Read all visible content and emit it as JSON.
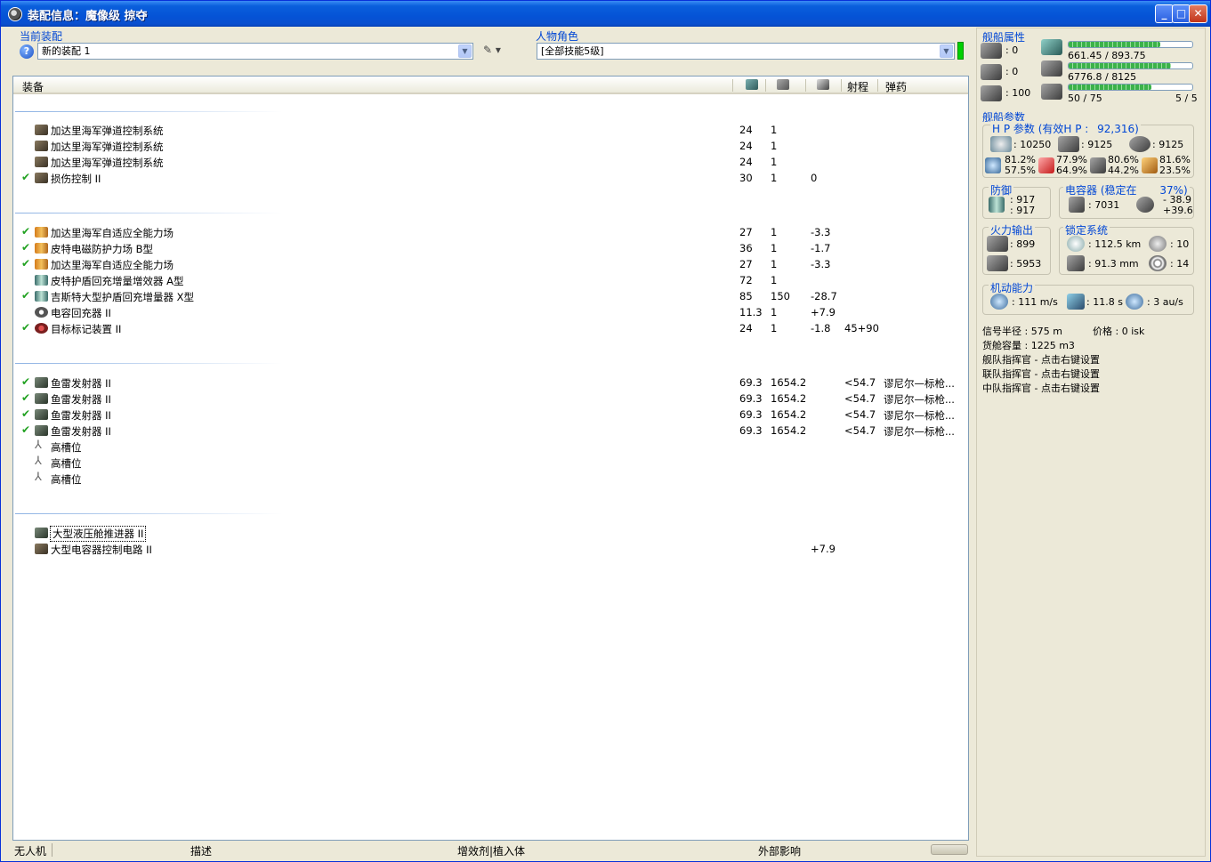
{
  "window": {
    "title": "装配信息：魔像级 掠夺",
    "buttons": {
      "minimize": "_",
      "maximize": "□",
      "close": "✕"
    }
  },
  "fitting": {
    "label": "当前装配",
    "value": "新的装配  1",
    "arrow": "▼",
    "help": "?",
    "tools": "✎ ▾"
  },
  "character": {
    "label": "人物角色",
    "value": "[全部技能5级]",
    "arrow": "▼"
  },
  "list": {
    "headers": {
      "equipment": "装备",
      "range": "射程",
      "ammo": "弹药"
    },
    "rows": [
      {
        "check": "",
        "icon": "module",
        "name": "加达里海军弹道控制系统",
        "c1": "24",
        "c2": "1",
        "c3": "",
        "c4": "",
        "c5": ""
      },
      {
        "check": "",
        "icon": "module",
        "name": "加达里海军弹道控制系统",
        "c1": "24",
        "c2": "1",
        "c3": "",
        "c4": "",
        "c5": ""
      },
      {
        "check": "",
        "icon": "module",
        "name": "加达里海军弹道控制系统",
        "c1": "24",
        "c2": "1",
        "c3": "",
        "c4": "",
        "c5": ""
      },
      {
        "check": "✔",
        "icon": "module",
        "name": "损伤控制 II",
        "c1": "30",
        "c2": "1",
        "c3": "0",
        "c4": "",
        "c5": ""
      },
      {
        "check": "✔",
        "icon": "shield",
        "name": "加达里海军自适应全能力场",
        "c1": "27",
        "c2": "1",
        "c3": "-3.3",
        "c4": "",
        "c5": ""
      },
      {
        "check": "✔",
        "icon": "shield",
        "name": "皮特电磁防护力场 B型",
        "c1": "36",
        "c2": "1",
        "c3": "-1.7",
        "c4": "",
        "c5": ""
      },
      {
        "check": "✔",
        "icon": "shield",
        "name": "加达里海军自适应全能力场",
        "c1": "27",
        "c2": "1",
        "c3": "-3.3",
        "c4": "",
        "c5": ""
      },
      {
        "check": "",
        "icon": "shield-b",
        "name": "皮特护盾回充增量增效器 A型",
        "c1": "72",
        "c2": "1",
        "c3": "",
        "c4": "",
        "c5": ""
      },
      {
        "check": "✔",
        "icon": "shield-b",
        "name": "吉斯特大型护盾回充增量器 X型",
        "c1": "85",
        "c2": "150",
        "c3": "-28.7",
        "c4": "",
        "c5": ""
      },
      {
        "check": "",
        "icon": "cap",
        "name": "电容回充器 II",
        "c1": "11.3",
        "c2": "1",
        "c3": "+7.9",
        "c4": "",
        "c5": ""
      },
      {
        "check": "✔",
        "icon": "target",
        "name": "目标标记装置 II",
        "c1": "24",
        "c2": "1",
        "c3": "-1.8",
        "c4": "45+90",
        "c5": ""
      },
      {
        "check": "✔",
        "icon": "launcher",
        "name": "鱼雷发射器 II",
        "c1": "69.3",
        "c2": "1654.2",
        "c3": "",
        "c4": "<54.7",
        "c5": "谬尼尔—标枪..."
      },
      {
        "check": "✔",
        "icon": "launcher",
        "name": "鱼雷发射器 II",
        "c1": "69.3",
        "c2": "1654.2",
        "c3": "",
        "c4": "<54.7",
        "c5": "谬尼尔—标枪..."
      },
      {
        "check": "✔",
        "icon": "launcher",
        "name": "鱼雷发射器 II",
        "c1": "69.3",
        "c2": "1654.2",
        "c3": "",
        "c4": "<54.7",
        "c5": "谬尼尔—标枪..."
      },
      {
        "check": "✔",
        "icon": "launcher",
        "name": "鱼雷发射器 II",
        "c1": "69.3",
        "c2": "1654.2",
        "c3": "",
        "c4": "<54.7",
        "c5": "谬尼尔—标枪..."
      },
      {
        "check": "",
        "icon": "slot",
        "name": "高槽位",
        "c1": "",
        "c2": "",
        "c3": "",
        "c4": "",
        "c5": ""
      },
      {
        "check": "",
        "icon": "slot",
        "name": "高槽位",
        "c1": "",
        "c2": "",
        "c3": "",
        "c4": "",
        "c5": ""
      },
      {
        "check": "",
        "icon": "slot",
        "name": "高槽位",
        "c1": "",
        "c2": "",
        "c3": "",
        "c4": "",
        "c5": ""
      },
      {
        "check": "",
        "icon": "launcher",
        "name": "大型液压舱推进器 II",
        "c1": "",
        "c2": "",
        "c3": "",
        "c4": "",
        "c5": ""
      },
      {
        "check": "",
        "icon": "module",
        "name": "大型电容器控制电路 II",
        "c1": "",
        "c2": "",
        "c3": "+7.9",
        "c4": "",
        "c5": ""
      }
    ]
  },
  "bottom_tabs": [
    "无人机",
    "描述",
    "增效剂|植入体",
    "外部影响"
  ],
  "ship_attrs": {
    "title": "舰船属性",
    "slots": [
      ": 0",
      ": 0",
      ": 100"
    ],
    "cpu": {
      "text": "661.45 / 893.75",
      "fraction": 0.74
    },
    "power": {
      "text": "6776.8 / 8125",
      "fraction": 0.83
    },
    "calibration": {
      "text": "50 / 75",
      "fraction": 0.67
    },
    "rigs": "5 / 5"
  },
  "ship_params": {
    "title": "舰船参数",
    "hp_title": "H P 参数 (有效H P :",
    "ehp": "92,316)",
    "shield_hp": ": 10250",
    "armor_hp": ": 9125",
    "hull_hp": ": 9125",
    "resists": [
      {
        "a": "81.2%",
        "b": "57.5%"
      },
      {
        "a": "77.9%",
        "b": "64.9%"
      },
      {
        "a": "80.6%",
        "b": "44.2%"
      },
      {
        "a": "81.6%",
        "b": "23.5%"
      }
    ]
  },
  "defense": {
    "title": "防御",
    "v1": ": 917",
    "v2": ": 917"
  },
  "capacitor": {
    "title": "电容器 (稳定在",
    "percent": "37%)",
    "value": ": 7031",
    "delta1": "- 38.9",
    "delta2": "+39.6"
  },
  "firepower": {
    "title": "火力输出",
    "dps": ": 899",
    "volley": ": 5953"
  },
  "targeting": {
    "title": "锁定系统",
    "range": ": 112.5 km",
    "targets": ": 10",
    "scan": ": 91.3 mm",
    "sensor": ": 14"
  },
  "mobility": {
    "title": "机动能力",
    "speed": ": 111 m/s",
    "align": ": 11.8 s",
    "warp": ": 3 au/s"
  },
  "misc": {
    "signature": "信号半径 : 575 m",
    "price": "价格 : 0 isk",
    "cargo": "货舱容量 : 1225 m3",
    "fleet": "舰队指挥官 - 点击右键设置",
    "wing": "联队指挥官 - 点击右键设置",
    "squad": "中队指挥官 - 点击右键设置"
  }
}
